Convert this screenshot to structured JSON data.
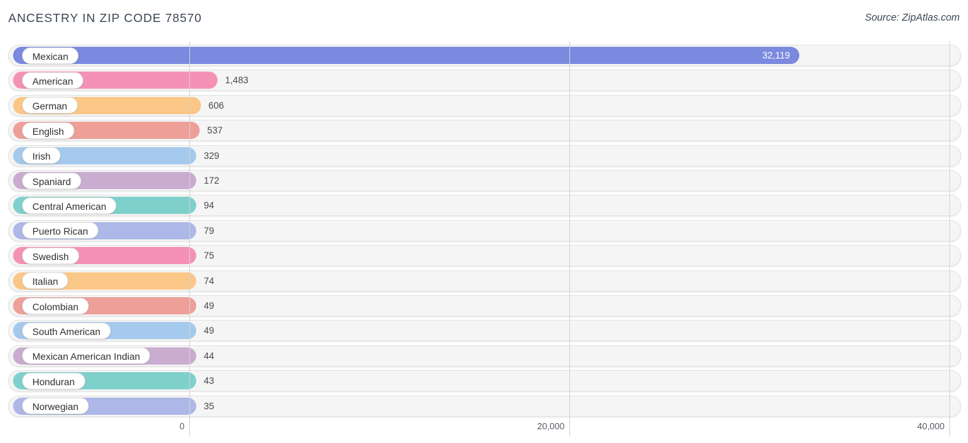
{
  "header": {
    "title": "ANCESTRY IN ZIP CODE 78570",
    "source": "Source: ZipAtlas.com"
  },
  "chart_data": {
    "type": "bar",
    "orientation": "horizontal",
    "title": "ANCESTRY IN ZIP CODE 78570",
    "subtitle": "",
    "xlabel": "",
    "ylabel": "",
    "xlim": [
      0,
      40000
    ],
    "grid": true,
    "legend": false,
    "source": "Source: ZipAtlas.com",
    "xticks": [
      0,
      20000,
      40000
    ],
    "xtick_labels": [
      "0",
      "20,000",
      "40,000"
    ],
    "categories": [
      "Mexican",
      "American",
      "German",
      "English",
      "Irish",
      "Spaniard",
      "Central American",
      "Puerto Rican",
      "Swedish",
      "Italian",
      "Colombian",
      "South American",
      "Mexican American Indian",
      "Honduran",
      "Norwegian"
    ],
    "values": [
      32119,
      1483,
      606,
      537,
      329,
      172,
      94,
      79,
      75,
      74,
      49,
      49,
      44,
      43,
      35
    ],
    "value_labels": [
      "32,119",
      "1,483",
      "606",
      "537",
      "329",
      "172",
      "94",
      "79",
      "75",
      "74",
      "49",
      "49",
      "44",
      "43",
      "35"
    ],
    "colors": [
      "#7b89de",
      "#f691b6",
      "#fbc786",
      "#ed9f98",
      "#a5c9ec",
      "#c9acd0",
      "#7ed0cb",
      "#adb7e8",
      "#f691b6",
      "#fbc786",
      "#ed9f98",
      "#a5c9ec",
      "#c9acd0",
      "#7ed0cb",
      "#adb7e8"
    ]
  },
  "palette": {
    "track_fill": "#f5f5f5",
    "track_border": "#e4e4e4",
    "gridline": "#d2d2d2",
    "title_color": "#3c4653",
    "value_color": "#4a4a4a",
    "value_inside_color": "#ffffff",
    "background": "#ffffff"
  }
}
